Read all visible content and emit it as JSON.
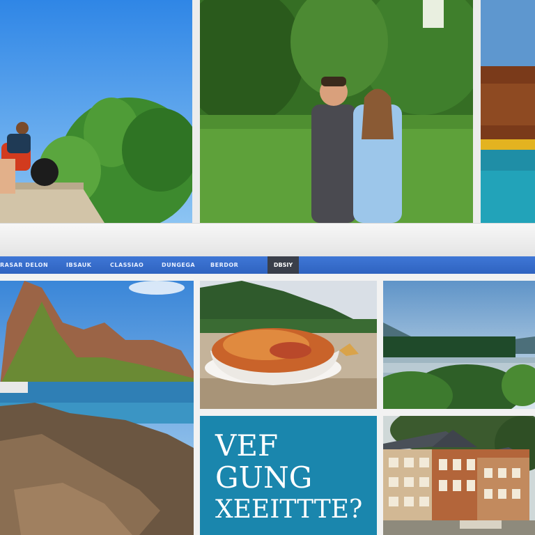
{
  "navbar": {
    "items": [
      "RASAR DELON",
      "IBSAUK",
      "CLASSIAO",
      "DUNGEGA",
      "BERDOR"
    ],
    "active_button": "DBSIY"
  },
  "promo": {
    "line1": "VEF",
    "line2": "GUNG",
    "line3": "XEEITTTE?"
  },
  "colors": {
    "nav": "#3a6fd0",
    "promo_bg": "#1a86ad",
    "active_button": "#3a3f4a"
  },
  "images": {
    "top": [
      "person-on-ledge-photo",
      "couple-in-park-photo",
      "red-crater-pool-photo"
    ],
    "bottom": [
      "mountain-coast-photo",
      "pasta-bowl-photo",
      "lake-forest-photo",
      "promo-card",
      "lodge-building-photo"
    ]
  }
}
